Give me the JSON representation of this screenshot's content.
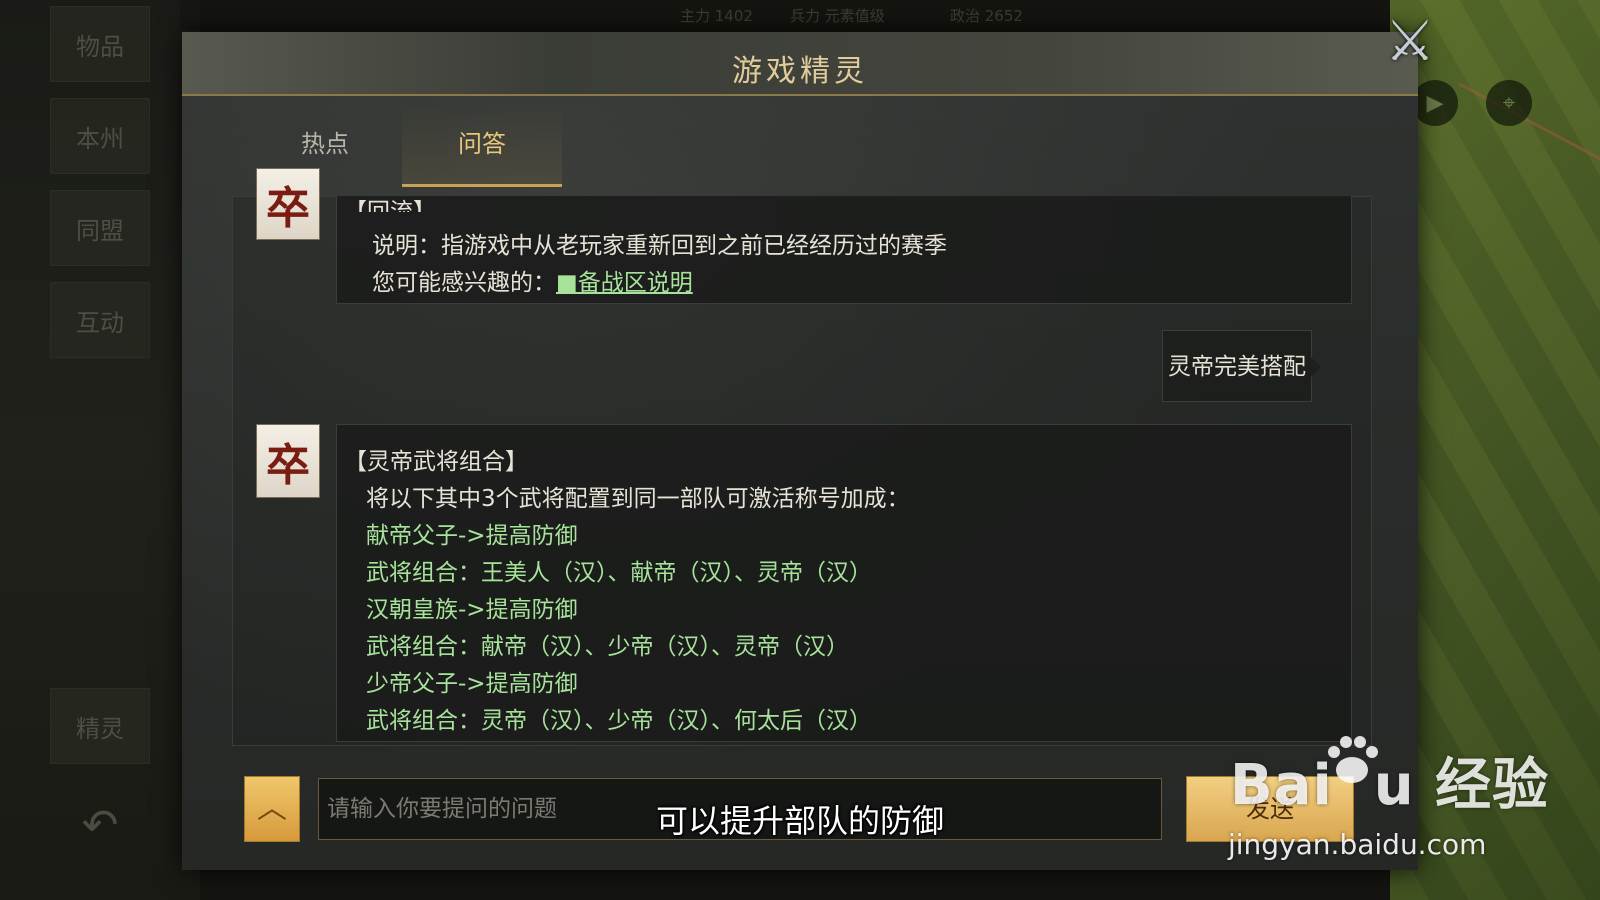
{
  "background": {
    "sidebar_items": [
      "物品",
      "本州",
      "同盟",
      "互动",
      "精灵"
    ],
    "top_strip": [
      "主力 1402",
      "兵力 元素值级",
      "政治 2652"
    ]
  },
  "dialog": {
    "title": "游戏精灵",
    "close_icon": "crossed-swords-icon",
    "tabs": [
      {
        "label": "热点",
        "active": false
      },
      {
        "label": "问答",
        "active": true
      }
    ]
  },
  "chat": {
    "messages": [
      {
        "sender": "bot",
        "avatar_glyph": "卒",
        "lines": [
          {
            "text": "【回流】",
            "color": "white"
          },
          {
            "text": "说明：指游戏中从老玩家重新回到之前已经经历过的赛季",
            "color": "white"
          },
          {
            "text": "您可能感兴趣的：",
            "color": "white",
            "link": "■备战区说明"
          }
        ]
      },
      {
        "sender": "user",
        "text": "灵帝完美搭配"
      },
      {
        "sender": "bot",
        "avatar_glyph": "卒",
        "lines": [
          {
            "text": "【灵帝武将组合】",
            "color": "white"
          },
          {
            "text": "将以下其中3个武将配置到同一部队可激活称号加成：",
            "color": "white"
          },
          {
            "text": "献帝父子->提高防御",
            "color": "green"
          },
          {
            "text": "武将组合：王美人（汉）、献帝（汉）、灵帝（汉）",
            "color": "green"
          },
          {
            "text": "汉朝皇族->提高防御",
            "color": "green"
          },
          {
            "text": "武将组合：献帝（汉）、少帝（汉）、灵帝（汉）",
            "color": "green"
          },
          {
            "text": "少帝父子->提高防御",
            "color": "green"
          },
          {
            "text": "武将组合：灵帝（汉）、少帝（汉）、何太后（汉）",
            "color": "green"
          }
        ]
      }
    ]
  },
  "input": {
    "placeholder": "请输入你要提问的问题",
    "value": "",
    "expand_icon": "chevron-up-icon",
    "send_label": "发送"
  },
  "video_subtitle": "可以提升部队的防御",
  "watermark": {
    "logo_text": "Bai du 经验",
    "url": "jingyan.baidu.com"
  },
  "colors": {
    "title": "#e0cc9a",
    "active_tab": "#e6c77c",
    "green_text": "#a6e29a",
    "button_gold": "#e0b060"
  }
}
